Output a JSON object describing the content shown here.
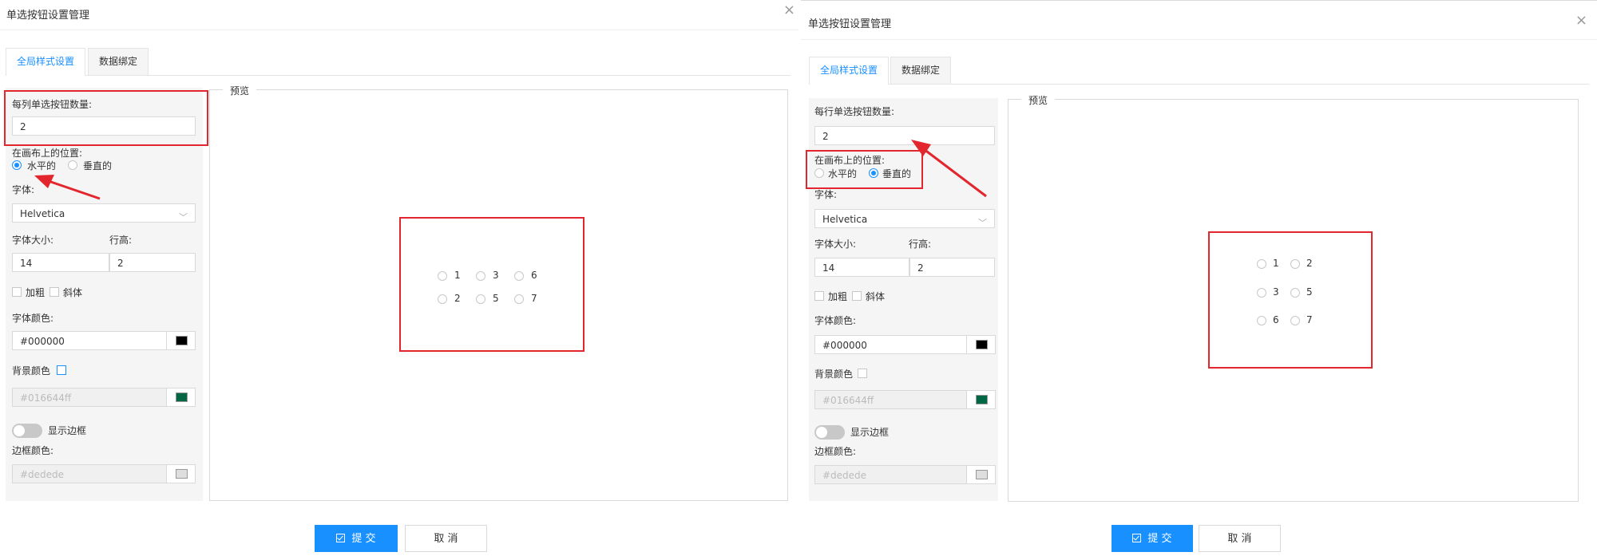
{
  "colors": {
    "accent": "#1890ff",
    "highlight": "#e3262e",
    "font_color": "#000000",
    "bg_color": "#016644",
    "border_color": "#dedede"
  },
  "left": {
    "dialog_title": "单选按钮设置管理",
    "close_icon": "×",
    "tabs": [
      "全局样式设置",
      "数据绑定"
    ],
    "count_label": "每列单选按钮数量:",
    "count_value": "2",
    "position_label": "在画布上的位置:",
    "position_options": [
      "水平的",
      "垂直的"
    ],
    "position_selected": "水平的",
    "font_label": "字体:",
    "font_value": "Helvetica",
    "font_size_label": "字体大小:",
    "line_height_label": "行高:",
    "font_size_value": "14",
    "line_height_value": "2",
    "bold_label": "加粗",
    "italic_label": "斜体",
    "font_color_label": "字体颜色:",
    "font_color_value": "#000000",
    "bg_color_label": "背景颜色",
    "bg_color_value": "#016644ff",
    "show_border_label": "显示边框",
    "border_color_label": "边框颜色:",
    "border_color_value": "#dedede",
    "preview_label": "预览",
    "preview_options": [
      [
        "1",
        "3",
        "6"
      ],
      [
        "2",
        "5",
        "7"
      ]
    ],
    "submit_label": "提 交",
    "cancel_label": "取 消"
  },
  "right": {
    "dialog_title": "单选按钮设置管理",
    "close_icon": "×",
    "tabs": [
      "全局样式设置",
      "数据绑定"
    ],
    "count_label": "每行单选按钮数量:",
    "count_value": "2",
    "position_label": "在画布上的位置:",
    "position_options": [
      "水平的",
      "垂直的"
    ],
    "position_selected": "垂直的",
    "font_label": "字体:",
    "font_value": "Helvetica",
    "font_size_label": "字体大小:",
    "line_height_label": "行高:",
    "font_size_value": "14",
    "line_height_value": "2",
    "bold_label": "加粗",
    "italic_label": "斜体",
    "font_color_label": "字体颜色:",
    "font_color_value": "#000000",
    "bg_color_label": "背景颜色",
    "bg_color_value": "#016644ff",
    "show_border_label": "显示边框",
    "border_color_label": "边框颜色:",
    "border_color_value": "#dedede",
    "preview_label": "预览",
    "preview_options": [
      [
        "1",
        "2"
      ],
      [
        "3",
        "5"
      ],
      [
        "6",
        "7"
      ]
    ],
    "submit_label": "提 交",
    "cancel_label": "取 消"
  }
}
